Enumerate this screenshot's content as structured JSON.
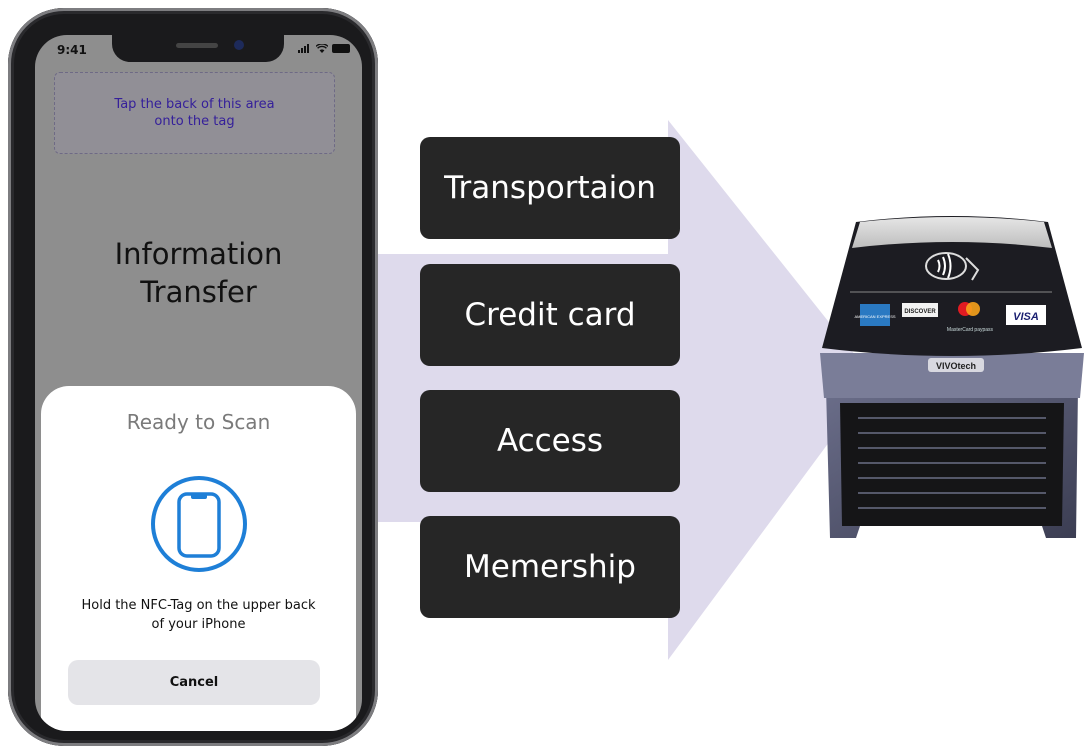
{
  "phone": {
    "status_time": "9:41",
    "tap_area_text": "Tap the back of this area\nonto the tag",
    "info_title": "Information\nTransfer",
    "sheet": {
      "title": "Ready to Scan",
      "icon": "phone-scan-icon",
      "message": "Hold the NFC-Tag on the upper back\nof your iPhone",
      "cancel_label": "Cancel"
    }
  },
  "categories": [
    "Transportaion",
    "Credit card",
    "Access",
    "Memership"
  ],
  "terminal": {
    "brand": "VIVOtech",
    "card_logos": [
      "AMERICAN EXPRESS",
      "DISCOVER",
      "MasterCard paypass",
      "VISA"
    ],
    "icon": "contactless-icon"
  },
  "colors": {
    "arrow": "#dedaec",
    "category_bg": "#262626",
    "tap_text": "#35209a",
    "scan_ring": "#1e7fd7"
  }
}
